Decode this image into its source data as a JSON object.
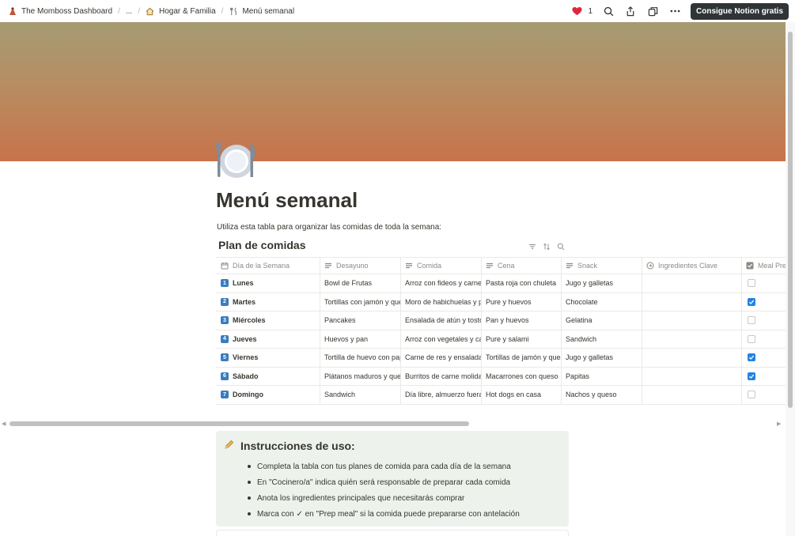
{
  "breadcrumbs": [
    {
      "icon": "workspace-logo-icon",
      "label": "The Momboss Dashboard"
    },
    {
      "icon": "",
      "label": "..."
    },
    {
      "icon": "house-icon",
      "label": "Hogar & Familia"
    },
    {
      "icon": "fork-knife-icon",
      "label": "Menú semanal"
    }
  ],
  "topbar": {
    "like_count": "1",
    "cta_label": "Consigue Notion gratis"
  },
  "page": {
    "title": "Menú semanal",
    "intro": "Utiliza esta tabla para organizar las comidas de toda la semana:"
  },
  "database": {
    "title": "Plan de comidas",
    "columns": [
      "Día de la Semana",
      "Desayuno",
      "Comida",
      "Cena",
      "Snack",
      "Ingredientes Clave",
      "Meal Pre"
    ],
    "rows": [
      {
        "num": "1",
        "day": "Lunes",
        "desayuno": "Bowl de Frutas",
        "comida": "Arroz con fideos y carne g",
        "cena": "Pasta roja con chuleta",
        "snack": "Jugo y galletas",
        "ingredientes": "",
        "prep": false
      },
      {
        "num": "2",
        "day": "Martes",
        "desayuno": "Tortillas con jamón y ques",
        "comida": "Moro de habichuelas y po",
        "cena": "Pure y huevos",
        "snack": "Chocolate",
        "ingredientes": "",
        "prep": true
      },
      {
        "num": "3",
        "day": "Miércoles",
        "desayuno": "Pancakes",
        "comida": "Ensalada de atún y tostor",
        "cena": "Pan y huevos",
        "snack": "Gelatina",
        "ingredientes": "",
        "prep": false
      },
      {
        "num": "4",
        "day": "Jueves",
        "desayuno": "Huevos y pan",
        "comida": "Arroz con vegetales y car",
        "cena": "Pure y salami",
        "snack": "Sandwich",
        "ingredientes": "",
        "prep": false
      },
      {
        "num": "5",
        "day": "Viernes",
        "desayuno": "Tortilla de huevo con pap",
        "comida": "Carne de res y ensalada",
        "cena": "Tortillas de jamón y ques",
        "snack": "Jugo y galletas",
        "ingredientes": "",
        "prep": true
      },
      {
        "num": "6",
        "day": "Sábado",
        "desayuno": "Plátanos maduros y ques",
        "comida": "Burritos de carne molida",
        "cena": "Macarrones con queso",
        "snack": "Papitas",
        "ingredientes": "",
        "prep": true
      },
      {
        "num": "7",
        "day": "Domingo",
        "desayuno": "Sandwich",
        "comida": "Día libre, almuerzo fuera",
        "cena": "Hot dogs en casa",
        "snack": "Nachos y queso",
        "ingredientes": "",
        "prep": false
      }
    ]
  },
  "callout": {
    "title": "Instrucciones de uso:",
    "items": [
      "Completa la tabla con tus planes de comida para cada día de la semana",
      "En \"Cocinero/a\" indica quién será responsable de preparar cada comida",
      "Anota los ingredientes principales que necesitarás comprar",
      "Marca con ✓ en \"Prep meal\" si la comida puede prepararse con antelación"
    ]
  },
  "colors": {
    "accent": "#2383e2",
    "number_badge": "#3a7cc0",
    "callout_bg": "#edf3ec",
    "cta_bg": "#2f3437"
  }
}
